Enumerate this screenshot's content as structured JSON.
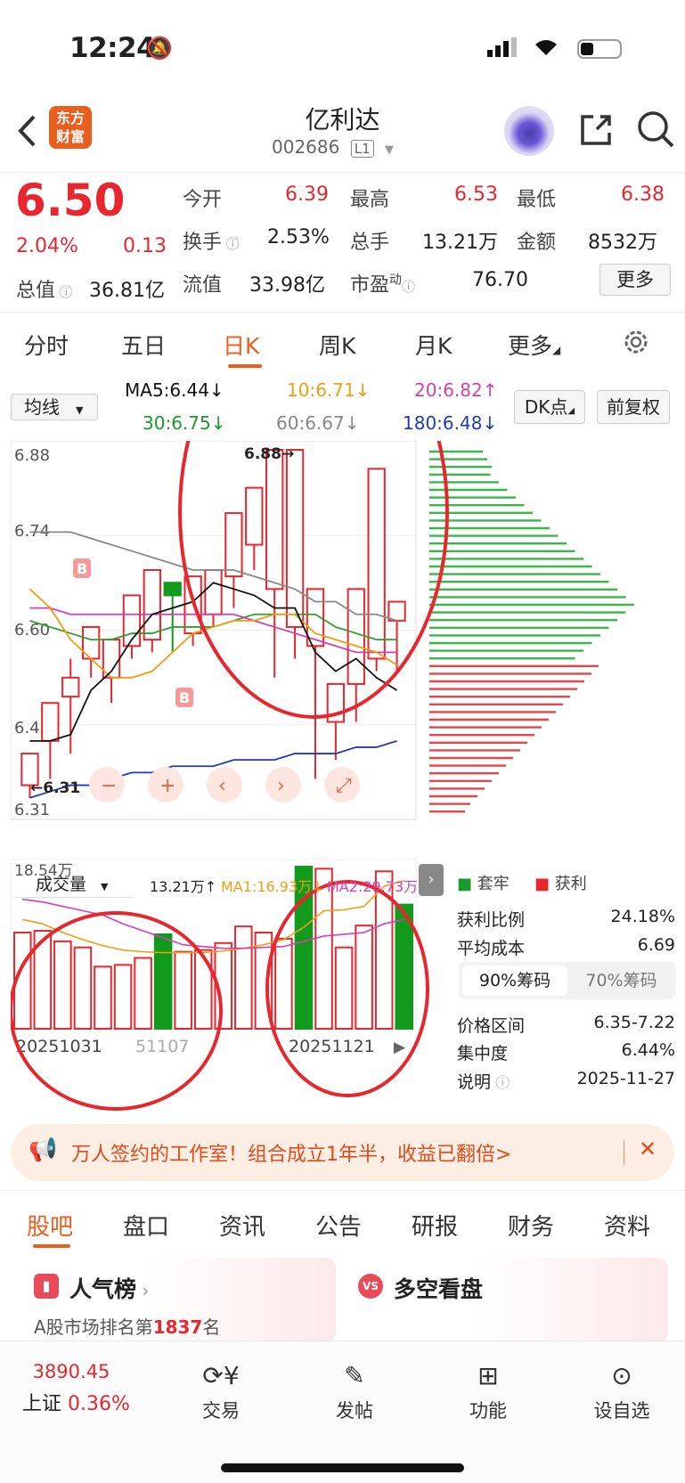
{
  "status": {
    "time": "12:24"
  },
  "nav": {
    "brand_line1": "东方",
    "brand_line2": "财富",
    "title": "亿利达",
    "code": "002686",
    "level": "L1"
  },
  "quote": {
    "price": "6.50",
    "pct": "2.04%",
    "change": "0.13",
    "open_label": "今开",
    "open": "6.39",
    "high_label": "最高",
    "high": "6.53",
    "low_label": "最低",
    "low": "6.38",
    "turnover_label": "换手",
    "turnover": "2.53%",
    "volume_label": "总手",
    "volume": "13.21万",
    "amount_label": "金额",
    "amount": "8532万",
    "mcap_label": "总值",
    "mcap": "36.81亿",
    "float_label": "流值",
    "float": "33.98亿",
    "pe_label": "市盈",
    "pe_sup": "动",
    "pe": "76.70",
    "more": "更多"
  },
  "tabs": [
    "分时",
    "五日",
    "日K",
    "周K",
    "月K",
    "更多"
  ],
  "active_tab": "日K",
  "chart": {
    "ma_select": "均线",
    "ma5": "MA5:6.44↓",
    "ma10": "10:6.71↓",
    "ma20": "20:6.82↑",
    "ma30": "30:6.75↓",
    "ma60": "60:6.67↓",
    "ma180": "180:6.48↓",
    "dk": "DK点",
    "fq": "前复权",
    "y_labels": [
      "6.88",
      "6.74",
      "6.60",
      "6.45",
      "6.31"
    ],
    "hi_marker": "6.88→",
    "lo_marker": "←6.31",
    "buy_marker": "B",
    "vol_select": "成交量",
    "vol": "13.21万↑",
    "vol_ma1": "MA1:16.93万↓",
    "vol_ma2": "MA2:29.73万↓",
    "vol_max": "18.54万",
    "date1": "20251031",
    "date2": "51107",
    "date3": "20251121",
    "chip_legend_a": "套牢",
    "chip_legend_b": "获利",
    "colors": {
      "up": "#e8262e",
      "down": "#119a1c",
      "ma5": "#111111",
      "ma10": "#f39c12",
      "ma20": "#d63fb0",
      "ma30": "#2ca02c",
      "ma60": "#888888",
      "ma180": "#1f3cb4"
    }
  },
  "chart_data": {
    "type": "candlestick",
    "ohlc": [
      [
        6.35,
        6.4,
        6.33,
        6.38
      ],
      [
        6.42,
        6.48,
        6.36,
        6.47
      ],
      [
        6.49,
        6.52,
        6.4,
        6.55
      ],
      [
        6.55,
        6.6,
        6.52,
        6.58
      ],
      [
        6.52,
        6.58,
        6.48,
        6.56
      ],
      [
        6.57,
        6.65,
        6.55,
        6.62
      ],
      [
        6.58,
        6.69,
        6.56,
        6.67
      ],
      [
        6.67,
        6.65,
        6.56,
        6.58
      ],
      [
        6.59,
        6.68,
        6.57,
        6.67
      ],
      [
        6.62,
        6.69,
        6.6,
        6.67
      ],
      [
        6.68,
        6.78,
        6.63,
        6.75
      ],
      [
        6.73,
        6.82,
        6.69,
        6.66
      ],
      [
        6.66,
        6.88,
        6.52,
        6.66
      ],
      [
        6.6,
        6.88,
        6.55,
        6.57
      ],
      [
        6.57,
        6.66,
        6.36,
        6.43
      ],
      [
        6.45,
        6.51,
        6.39,
        6.48
      ],
      [
        6.51,
        6.66,
        6.45,
        6.57
      ],
      [
        6.55,
        6.85,
        6.53,
        6.64
      ],
      [
        6.61,
        6.64,
        6.53,
        6.5
      ]
    ],
    "ma5": [
      6.42,
      6.42,
      6.43,
      6.5,
      6.53,
      6.58,
      6.62,
      6.63,
      6.64,
      6.67,
      6.66,
      6.65,
      6.63,
      6.63,
      6.56,
      6.53,
      6.55,
      6.52,
      6.5
    ],
    "ma10": [
      6.66,
      6.63,
      6.58,
      6.55,
      6.52,
      6.52,
      6.53,
      6.56,
      6.59,
      6.6,
      6.61,
      6.61,
      6.62,
      6.62,
      6.59,
      6.58,
      6.57,
      6.56,
      6.54
    ],
    "ma20": [
      6.63,
      6.63,
      6.62,
      6.62,
      6.62,
      6.62,
      6.62,
      6.62,
      6.62,
      6.62,
      6.62,
      6.61,
      6.6,
      6.59,
      6.58,
      6.57,
      6.56,
      6.56,
      6.56
    ],
    "ma30": [
      6.61,
      6.6,
      6.59,
      6.58,
      6.58,
      6.59,
      6.59,
      6.6,
      6.6,
      6.6,
      6.61,
      6.62,
      6.62,
      6.62,
      6.62,
      6.6,
      6.59,
      6.58,
      6.58
    ],
    "ma60": [
      6.75,
      6.75,
      6.75,
      6.74,
      6.73,
      6.72,
      6.71,
      6.7,
      6.69,
      6.69,
      6.69,
      6.68,
      6.67,
      6.66,
      6.64,
      6.64,
      6.62,
      6.62,
      6.61
    ],
    "ma180": [
      6.33,
      6.34,
      6.35,
      6.35,
      6.36,
      6.37,
      6.37,
      6.38,
      6.38,
      6.38,
      6.39,
      6.39,
      6.39,
      6.4,
      6.4,
      6.4,
      6.41,
      6.41,
      6.42
    ],
    "volume": [
      11.0,
      11.2,
      10.0,
      9.3,
      7.1,
      7.3,
      8.1,
      10.8,
      8.8,
      9.0,
      9.8,
      11.7,
      11.0,
      10.3,
      18.54,
      18.3,
      9.3,
      11.8,
      18.0,
      14.2
    ],
    "vol_ma1": [
      12.5,
      12.0,
      11.0,
      10.2,
      9.5,
      9.0,
      8.8,
      8.7,
      8.7,
      8.7,
      8.9,
      9.2,
      9.6,
      10.2,
      11.6,
      13.5,
      13.6,
      14.0,
      16.3,
      16.93
    ],
    "vol_ma2": [
      14.8,
      14.5,
      14.0,
      13.5,
      13.0,
      12.0,
      11.2,
      10.4,
      9.6,
      9.4,
      9.2,
      9.2,
      9.3,
      9.4,
      10.0,
      10.6,
      10.8,
      11.0,
      12.0,
      12.5
    ],
    "ylim": [
      6.31,
      6.88
    ]
  },
  "chip": {
    "profit_label": "获利比例",
    "profit": "24.18%",
    "avg_label": "平均成本",
    "avg": "6.69",
    "tab90": "90%筹码",
    "tab70": "70%筹码",
    "range_label": "价格区间",
    "range": "6.35-7.22",
    "conc_label": "集中度",
    "conc": "6.44%",
    "note_label": "说明",
    "note_date": "2025-11-27"
  },
  "banner": {
    "text": "万人签约的工作室！组合成立1年半，收益已翻倍>",
    "close": "✕"
  },
  "subtabs": [
    "股吧",
    "盘口",
    "资讯",
    "公告",
    "研报",
    "财务",
    "资料"
  ],
  "cards": {
    "a_title": "人气榜",
    "a_text_prefix": "A股市场排名第",
    "a_rank": "1837",
    "a_suffix": "名",
    "b_title": "多空看盘"
  },
  "bottom": {
    "index_value": "3890.45",
    "index_name": "上证",
    "index_pct": "0.36%",
    "items": [
      "交易",
      "发帖",
      "功能",
      "设自选"
    ]
  }
}
